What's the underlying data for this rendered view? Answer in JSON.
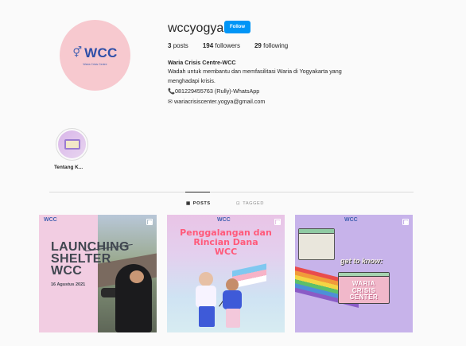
{
  "profile": {
    "avatar_logo": "WCC",
    "avatar_sub": "Waria Crisis Centre",
    "username": "wccyogya",
    "follow_label": "Follow"
  },
  "stats": {
    "posts_count": "3",
    "posts_label": "posts",
    "followers_count": "194",
    "followers_label": "followers",
    "following_count": "29",
    "following_label": "following"
  },
  "bio": {
    "name": "Waria Crisis Centre-WCC",
    "line1": "Wadah untuk membantu dan memfasilitasi Waria di Yogyakarta yang",
    "line2": "menghadapi krisis.",
    "phone": "081229455763 (Rully)-WhatsApp",
    "email": "wariacrisiscenter.yogya@gmail.com"
  },
  "highlight": {
    "label": "Tentang K..."
  },
  "tabs": {
    "posts": "POSTS",
    "tagged": "TAGGED"
  },
  "posts": [
    {
      "logo": "WCC",
      "title_line1": "LAUNCHING",
      "title_line2": "SHELTER",
      "title_line3": "WCC",
      "date": "16 Agustus 2021"
    },
    {
      "logo": "WCC",
      "title_line1": "Penggalangan dan",
      "title_line2": "Rincian Dana",
      "title_line3": "WCC"
    },
    {
      "logo": "WCC",
      "headline": "get to know:",
      "card_line1": "WARIA",
      "card_line2": "CRISIS",
      "card_line3": "CENTER"
    }
  ],
  "colors": {
    "follow_button": "#0095f6",
    "avatar_bg": "#f7c9cf",
    "logo_blue": "#2f4fa8"
  },
  "icons": {
    "phone": "phone-icon",
    "email": "envelope-icon",
    "posts_tab": "grid-icon",
    "tagged_tab": "tag-icon",
    "carousel": "multi-image-icon",
    "gender": "gender-symbol-icon"
  }
}
